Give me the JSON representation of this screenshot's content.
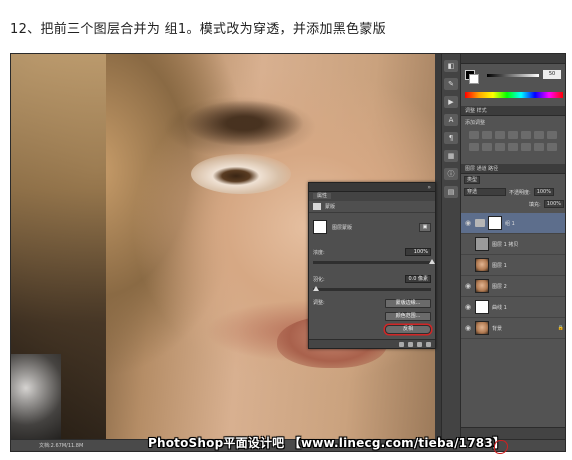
{
  "caption": "12、把前三个图层合并为 组1。模式改为穿透，并添加黑色蒙版",
  "statusbar": {
    "doc_info": "文档:2.67M/11.8M"
  },
  "color_panel": {
    "slider_value": "50"
  },
  "adjust_panel": {
    "tab_label": "调整  样式",
    "hint": "添加调整"
  },
  "layers_panel": {
    "tabs": "图层  通道  路径",
    "kind_label": "类型",
    "blend_mode": "穿透",
    "opacity_label": "不透明度:",
    "opacity_value": "100%",
    "fill_label": "填充:",
    "fill_value": "100%",
    "layers": [
      {
        "name": "组 1",
        "thumb": "white",
        "active": true
      },
      {
        "name": "图层 1 拷贝",
        "thumb": "gray",
        "active": false
      },
      {
        "name": "图层 1",
        "thumb": "face",
        "active": false
      },
      {
        "name": "图层 2",
        "thumb": "face",
        "active": false
      },
      {
        "name": "曲线 1",
        "thumb": "white",
        "active": false
      },
      {
        "name": "背景",
        "thumb": "face",
        "active": false
      }
    ]
  },
  "properties_panel": {
    "title": "属性",
    "subhead": "蒙版",
    "mask_label": "图层蒙版",
    "density_label": "浓度:",
    "density_value": "100%",
    "feather_label": "羽化:",
    "feather_value": "0.0 像素",
    "refine_label": "调整:",
    "edge_button": "蒙版边缘...",
    "color_range_button": "颜色范围...",
    "invert_button": "反相"
  },
  "watermark": "PhotoShop平面设计吧 【www.linecg.com/tieba/1783】"
}
